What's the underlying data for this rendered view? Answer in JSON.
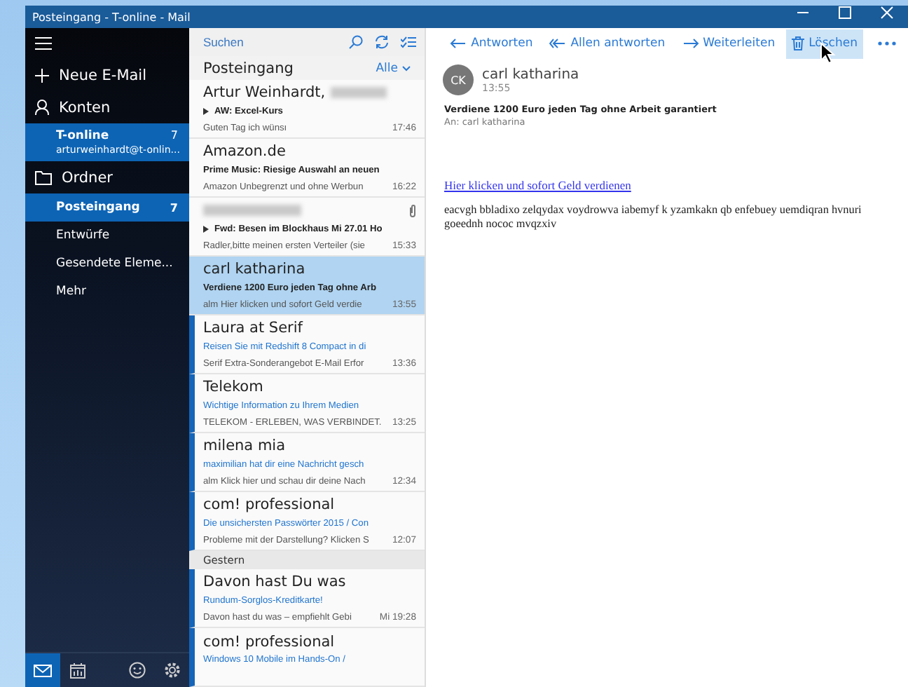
{
  "window": {
    "title": "Posteingang - T-online - Mail"
  },
  "sidebar": {
    "new_mail": "Neue E-Mail",
    "accounts_label": "Konten",
    "accounts": [
      {
        "name": "T-online",
        "address": "arturweinhardt@t-onlin...",
        "count": "7",
        "selected": true
      }
    ],
    "folders_label": "Ordner",
    "folders": [
      {
        "name": "Posteingang",
        "count": "7",
        "selected": true
      },
      {
        "name": "Entwürfe",
        "selected": false
      },
      {
        "name": "Gesendete Eleme...",
        "selected": false
      },
      {
        "name": "Mehr",
        "selected": false
      }
    ],
    "bottom_bar": [
      {
        "kind": "mail",
        "selected": true
      },
      {
        "kind": "calendar",
        "selected": false
      },
      {
        "kind": "feedback",
        "selected": false
      },
      {
        "kind": "settings",
        "selected": false
      }
    ]
  },
  "message_list": {
    "search": {
      "placeholder": "Suchen"
    },
    "folder_title": "Posteingang",
    "filter": "Alle",
    "groups": [
      {
        "rows": [
          {
            "sender": "Artur Weinhardt,",
            "redacted": true,
            "subject": "AW: Excel-Kurs",
            "preview": "Guten Tag ich wünsı",
            "time": "17:46",
            "unread": false,
            "selected": false,
            "attachment": false,
            "thread": true
          },
          {
            "sender": "Amazon.de",
            "redacted": false,
            "subject": "Prime Music: Riesige Auswahl an neuen",
            "preview": "Amazon Unbegrenzt und ohne Werbun",
            "time": "16:22",
            "unread": false,
            "selected": false,
            "attachment": false,
            "thread": false
          },
          {
            "redacted": true,
            "subject": "Fwd: Besen im Blockhaus Mi 27.01 Ho",
            "preview": "Radler,bitte meinen ersten Verteiler (sie",
            "time": "15:33",
            "unread": false,
            "selected": false,
            "attachment": true,
            "thread": true
          },
          {
            "sender": "carl katharina",
            "redacted": false,
            "subject": "Verdiene 1200 Euro jeden Tag ohne Arb",
            "preview": "alm Hier klicken und sofort Geld verdie",
            "time": "13:55",
            "unread": false,
            "selected": true,
            "attachment": false,
            "thread": false
          },
          {
            "sender": "Laura at Serif",
            "redacted": false,
            "subject": "Reisen Sie mit Redshift 8 Compact in di",
            "preview": "Serif Extra-Sonderangebot E-Mail Erfor",
            "time": "13:36",
            "unread": true,
            "selected": false,
            "attachment": false,
            "thread": false
          },
          {
            "sender": "Telekom",
            "redacted": false,
            "subject": "Wichtige Information zu Ihrem Medien",
            "preview": "TELEKOM - ERLEBEN, WAS VERBINDET.",
            "time": "13:25",
            "unread": true,
            "selected": false,
            "attachment": false,
            "thread": false
          },
          {
            "sender": "milena mia",
            "redacted": false,
            "subject": "maximilian hat dir eine Nachricht gesch",
            "preview": "alm Klick hier und schau dir deine Nach",
            "time": "12:34",
            "unread": true,
            "selected": false,
            "attachment": false,
            "thread": false
          },
          {
            "sender": "com! professional",
            "redacted": false,
            "subject": "Die unsichersten Passwörter 2015 / Con",
            "preview": "Probleme mit der Darstellung? Klicken S",
            "time": "12:07",
            "unread": true,
            "selected": false,
            "attachment": false,
            "thread": false
          }
        ]
      },
      {
        "label": "Gestern",
        "rows": [
          {
            "sender": "Davon hast Du was",
            "redacted": false,
            "subject": "Rundum-Sorglos-Kreditkarte!",
            "preview": "Davon hast du was – empfiehlt Gebi",
            "time": "Mi 19:28",
            "unread": true,
            "selected": false,
            "attachment": false,
            "thread": false
          },
          {
            "sender": "com! professional",
            "redacted": false,
            "subject": "Windows 10 Mobile im Hands-On /",
            "unread": true,
            "selected": false,
            "attachment": false,
            "thread": false
          }
        ]
      }
    ]
  },
  "toolbar": [
    {
      "kind": "reply",
      "label": "Antworten",
      "hovered": false
    },
    {
      "kind": "reply_all",
      "label": "Allen antworten",
      "hovered": false
    },
    {
      "kind": "forward",
      "label": "Weiterleiten",
      "hovered": false
    },
    {
      "kind": "delete",
      "label": "Löschen",
      "hovered": true
    }
  ],
  "message": {
    "avatar": "CK",
    "sender": "carl katharina",
    "time": "13:55",
    "subject": "Verdiene 1200 Euro jeden Tag ohne Arbeit garantiert",
    "to": "An: carl katharina",
    "link": "Hier klicken und sofort Geld verdienen",
    "body": "eacvgh bbladixo zelqydax voydrowva iabemyf k yzamkakn qb enfebuey uemdiqran hvnuri goeednh nococ mvqzxiv"
  }
}
